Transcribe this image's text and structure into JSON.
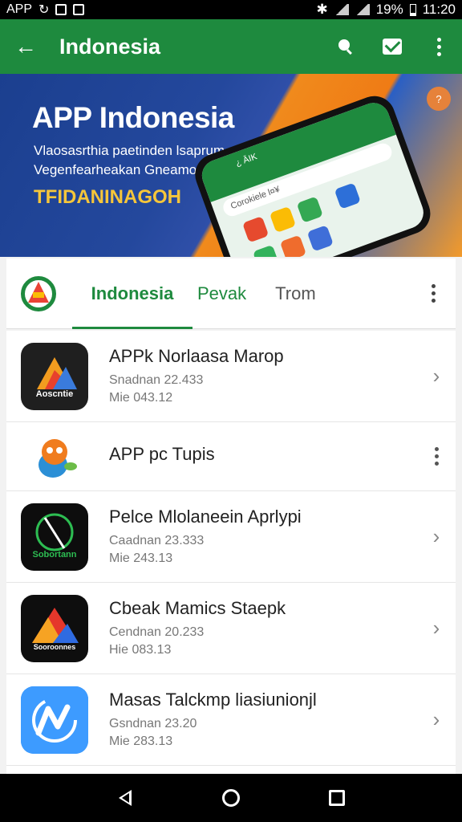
{
  "status": {
    "left_label": "APP",
    "battery": "19%",
    "time": "11:20"
  },
  "header": {
    "title": "Indonesia"
  },
  "banner": {
    "title": "APP Indonesia",
    "line1": "Vlaosasrthia paetinden lsaprum",
    "line2": "Vegenfearheakan Gneamohnan",
    "highlight": "TFIDANINAGOH",
    "badge": "?",
    "phone_header": "¿ ĀIK",
    "phone_search": "Corokiele l¤¥"
  },
  "tabs": [
    {
      "label": "Indonesia",
      "active": true
    },
    {
      "label": "Pevak"
    },
    {
      "label": "Trom"
    }
  ],
  "apps": [
    {
      "title": "APPk Norlaasa Marop",
      "line1": "Snadnan 22.433",
      "line2": "Mie 043.12",
      "icon_label": "Aoscntie",
      "colors": [
        "#1f1f1f",
        "#f29c1f",
        "#e8412c",
        "#3a7bdc"
      ],
      "action": "chevron"
    },
    {
      "title": "APP pc Tupis",
      "line1": "",
      "line2": "",
      "icon_label": "",
      "colors": [
        "#ffffff",
        "#f07c1e",
        "#2b8fd6",
        "#6cbc48"
      ],
      "action": "more"
    },
    {
      "title": "Pelce Mlolaneein Aprlypi",
      "line1": "Caadnan 23.333",
      "line2": "Mie 243.13",
      "icon_label": "Sobortann",
      "colors": [
        "#0d0d0d",
        "#2dbd52",
        "#ffffff",
        "#ffffff"
      ],
      "action": "chevron"
    },
    {
      "title": "Cbeak Mamics Staepk",
      "line1": "Cendnan 20.233",
      "line2": "Hie 083.13",
      "icon_label": "Sooroonnes",
      "colors": [
        "#0e0e0e",
        "#e5372b",
        "#f6a323",
        "#2f6be1"
      ],
      "action": "chevron"
    },
    {
      "title": "Masas Talckmp liasiunionjl",
      "line1": "Gsndnan 23.20",
      "line2": "Mie 283.13",
      "icon_label": "",
      "colors": [
        "#2d8df0",
        "#5db0ff",
        "#ffffff",
        "#ffffff"
      ],
      "action": "chevron"
    }
  ]
}
